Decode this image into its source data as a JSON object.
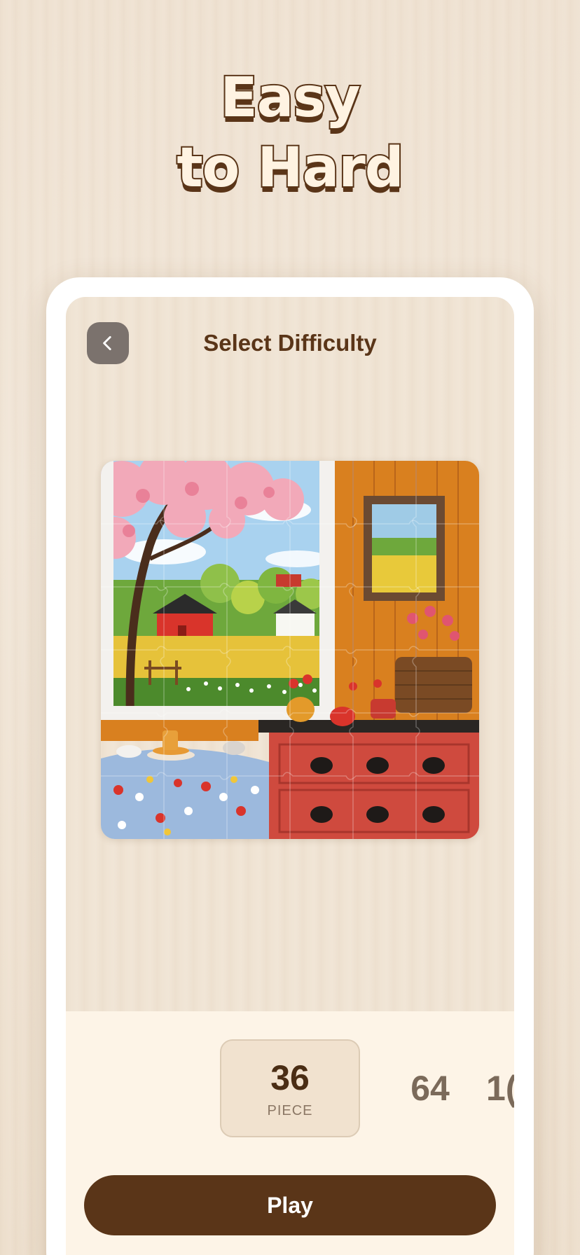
{
  "hero": {
    "line1": "Easy",
    "line2": "to Hard"
  },
  "screen": {
    "title": "Select Difficulty",
    "back_icon": "chevron-left-icon"
  },
  "difficulty": {
    "options": [
      {
        "count": "36",
        "unit": "PIECE",
        "selected": true
      },
      {
        "count": "64",
        "unit": "",
        "selected": false
      },
      {
        "count": "1(",
        "unit": "",
        "selected": false
      }
    ]
  },
  "actions": {
    "play_label": "Play"
  },
  "colors": {
    "brand_brown": "#5a3518",
    "back_button_gray": "#7b726d",
    "panel_cream": "#fdf4e7"
  }
}
